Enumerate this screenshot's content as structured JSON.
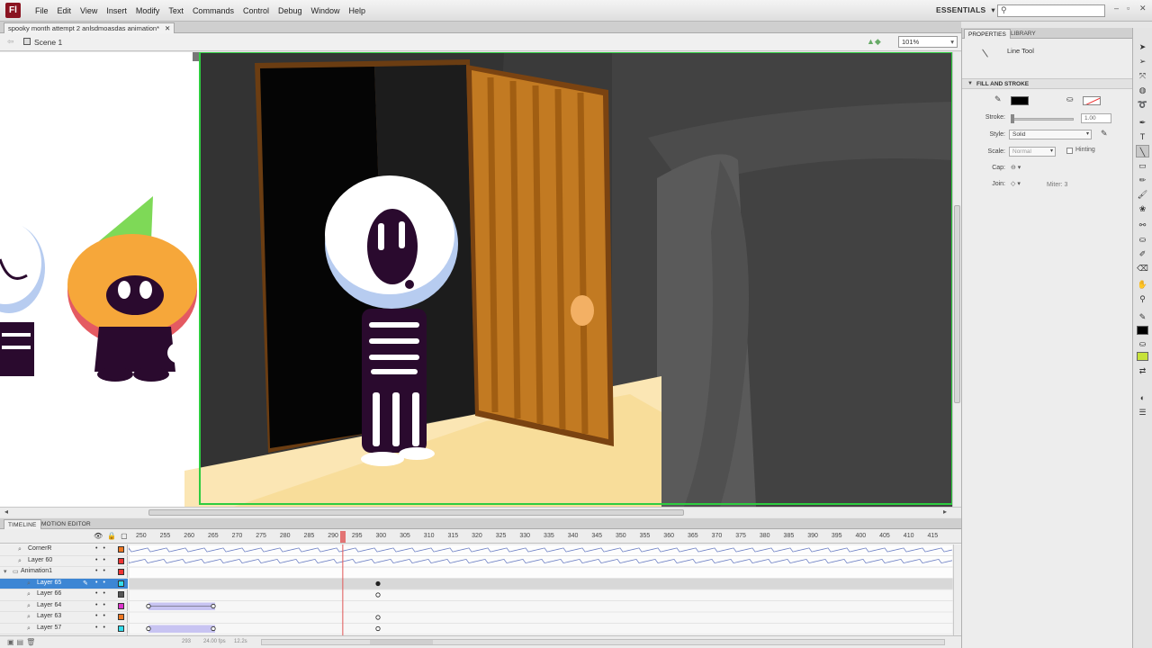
{
  "menubar": {
    "logo": "Fl",
    "items": [
      "File",
      "Edit",
      "View",
      "Insert",
      "Modify",
      "Text",
      "Commands",
      "Control",
      "Debug",
      "Window",
      "Help"
    ],
    "workspace": "ESSENTIALS",
    "search_placeholder": ""
  },
  "document": {
    "tab_title": "spooky month attempt 2 anlsdmoasdas animation*",
    "scene": "Scene 1",
    "zoom": "101%"
  },
  "timeline": {
    "tabs": [
      "TIMELINE",
      "MOTION EDITOR"
    ],
    "ruler": [
      "250",
      "255",
      "260",
      "265",
      "270",
      "275",
      "280",
      "285",
      "290",
      "295",
      "300",
      "305",
      "310",
      "315",
      "320",
      "325",
      "330",
      "335",
      "340",
      "345",
      "350",
      "355",
      "360",
      "365",
      "370",
      "375",
      "380",
      "385",
      "390",
      "395",
      "400",
      "405",
      "410",
      "415"
    ],
    "current_frame": 292,
    "layers": [
      {
        "name": "CornerR",
        "color": "#ee7722",
        "type": "layer",
        "selected": false
      },
      {
        "name": "Layer 60",
        "color": "#ee3333",
        "type": "layer",
        "selected": false
      },
      {
        "name": "Animation1",
        "color": "#ee3333",
        "type": "folder",
        "selected": false
      },
      {
        "name": "Layer 65",
        "color": "#33ddee",
        "type": "layer",
        "selected": true
      },
      {
        "name": "Layer 66",
        "color": "#555555",
        "type": "layer",
        "selected": false
      },
      {
        "name": "Layer 64",
        "color": "#dd33cc",
        "type": "layer",
        "selected": false
      },
      {
        "name": "Layer 63",
        "color": "#ee7722",
        "type": "layer",
        "selected": false
      },
      {
        "name": "Layer 57",
        "color": "#33ddee",
        "type": "layer",
        "selected": false
      }
    ],
    "status": [
      "293",
      "24.00 fps",
      "12.2s"
    ]
  },
  "properties": {
    "tabs": [
      "PROPERTIES",
      "LIBRARY"
    ],
    "tool_name": "Line Tool",
    "section": "FILL AND STROKE",
    "stroke_label": "Stroke:",
    "stroke_value": "1.00",
    "style_label": "Style:",
    "style_value": "Solid",
    "scale_label": "Scale:",
    "scale_value": "Normal",
    "hinting_label": "Hinting",
    "cap_label": "Cap:",
    "join_label": "Join:",
    "miter_label": "Miter: 3",
    "stroke_color": "#000000"
  },
  "colors": {
    "accent_selection": "#3d86d4",
    "playhead": "#e05555",
    "stage_border": "#2ecc40"
  }
}
